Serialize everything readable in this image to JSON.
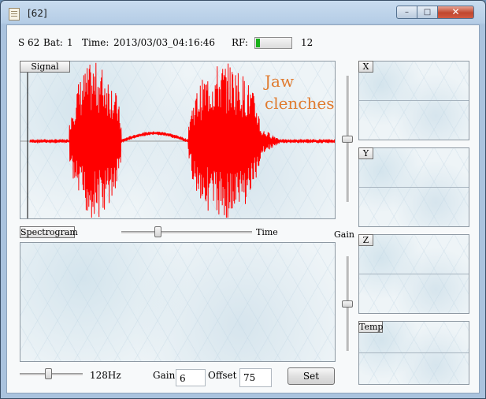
{
  "window": {
    "title": "[62]",
    "min_glyph": "–",
    "max_glyph": "□",
    "close_glyph": "✕"
  },
  "status": {
    "session": "S 62",
    "bat_label": "Bat:",
    "bat_value": "1",
    "time_label": "Time:",
    "time_value": "2013/03/03_04:16:46",
    "rf_label": "RF:",
    "rf_value": "12",
    "rf_level": 0.1,
    "rf_color": "#19b019"
  },
  "signal": {
    "tab_label": "Signal",
    "annotation_line1": "Jaw",
    "annotation_line2": "clenches",
    "trace_color": "#ff0000",
    "annotation_color": "#e07b2f"
  },
  "spectrogram": {
    "tab_label": "Spectrogram",
    "time_label": "Time",
    "time_slider_level": 0.27
  },
  "gain_slider": {
    "label": "Gain"
  },
  "axes": {
    "x": "X",
    "y": "Y",
    "z": "Z",
    "temp": "Temp"
  },
  "bottom": {
    "freq_label": "128Hz",
    "freq_slider_level": 0.45,
    "gain_label": "Gain",
    "gain_value": "6",
    "offset_label": "Offset",
    "offset_value": "75",
    "set_label": "Set"
  }
}
